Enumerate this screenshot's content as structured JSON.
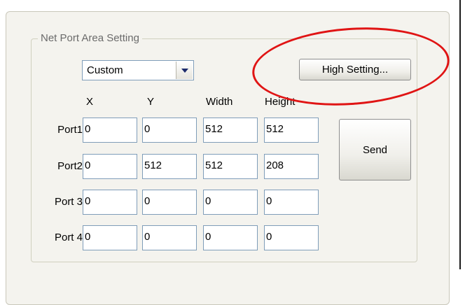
{
  "group": {
    "legend": "Net Port Area Setting"
  },
  "mode_select": {
    "value": "Custom"
  },
  "high_setting_label": "High Setting...",
  "send_label": "Send",
  "columns": [
    "X",
    "Y",
    "Width",
    "Height"
  ],
  "ports": [
    {
      "label": "Port1",
      "values": [
        "0",
        "0",
        "512",
        "512"
      ]
    },
    {
      "label": "Port2",
      "values": [
        "0",
        "512",
        "512",
        "208"
      ]
    },
    {
      "label": "Port 3",
      "values": [
        "0",
        "0",
        "0",
        "0"
      ]
    },
    {
      "label": "Port 4",
      "values": [
        "0",
        "0",
        "0",
        "0"
      ]
    }
  ],
  "annotation": {
    "shape": "ellipse",
    "color": "#e01414"
  }
}
